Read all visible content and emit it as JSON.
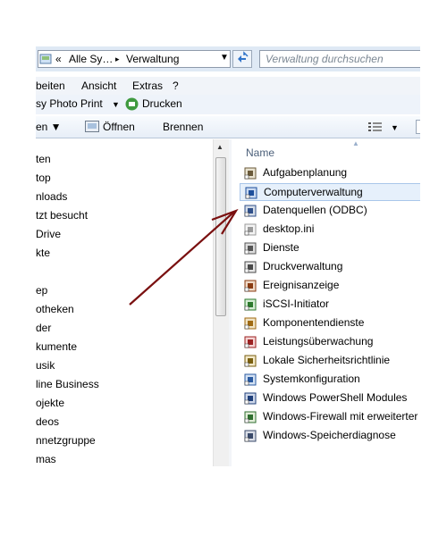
{
  "address_bar": {
    "crumbs": [
      "«",
      "Alle Sy…",
      "▸",
      "Verwaltung"
    ],
    "dropdown_glyph": "▼",
    "search_placeholder": "Verwaltung durchsuchen"
  },
  "menu": {
    "items": [
      "beiten",
      "Ansicht",
      "Extras",
      "?"
    ],
    "row2": [
      "sy Photo Print",
      "▼",
      "Drucken"
    ]
  },
  "toolbar": {
    "items": [
      "en ▼",
      "Öffnen",
      "Brennen"
    ],
    "view_glyph": "▼"
  },
  "nav_pane": {
    "items": [
      "ten",
      "top",
      "nloads",
      "tzt besucht",
      "Drive",
      "kte",
      "",
      "ep",
      "otheken",
      "der",
      "kumente",
      "usik",
      "line Business",
      "ojekte",
      "deos",
      "nnetzgruppe",
      "mas"
    ]
  },
  "file_list": {
    "column_header": "Name",
    "items": [
      {
        "name": "Aufgabenplanung",
        "icon": "task-scheduler-icon",
        "selected": false
      },
      {
        "name": "Computerverwaltung",
        "icon": "computer-management-icon",
        "selected": true
      },
      {
        "name": "Datenquellen (ODBC)",
        "icon": "odbc-icon",
        "selected": false
      },
      {
        "name": "desktop.ini",
        "icon": "ini-file-icon",
        "selected": false
      },
      {
        "name": "Dienste",
        "icon": "services-icon",
        "selected": false
      },
      {
        "name": "Druckverwaltung",
        "icon": "print-management-icon",
        "selected": false
      },
      {
        "name": "Ereignisanzeige",
        "icon": "event-viewer-icon",
        "selected": false
      },
      {
        "name": "iSCSI-Initiator",
        "icon": "iscsi-icon",
        "selected": false
      },
      {
        "name": "Komponentendienste",
        "icon": "component-services-icon",
        "selected": false
      },
      {
        "name": "Leistungsüberwachung",
        "icon": "performance-monitor-icon",
        "selected": false
      },
      {
        "name": "Lokale Sicherheitsrichtlinie",
        "icon": "security-policy-icon",
        "selected": false
      },
      {
        "name": "Systemkonfiguration",
        "icon": "system-config-icon",
        "selected": false
      },
      {
        "name": "Windows PowerShell Modules",
        "icon": "powershell-icon",
        "selected": false
      },
      {
        "name": "Windows-Firewall mit erweiterter",
        "icon": "firewall-icon",
        "selected": false
      },
      {
        "name": "Windows-Speicherdiagnose",
        "icon": "memory-diagnostic-icon",
        "selected": false
      }
    ]
  },
  "colors": {
    "arrow": "#7a1010",
    "selection_bg": "#e6f0fb",
    "selection_border": "#a9c6ea"
  }
}
